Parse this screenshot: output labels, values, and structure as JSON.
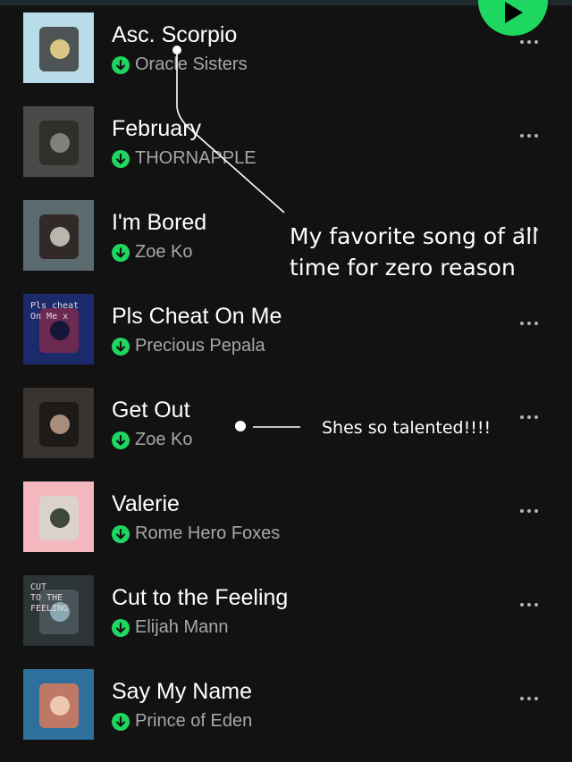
{
  "tracks": [
    {
      "title": "Asc. Scorpio",
      "artist": "Oracle Sisters",
      "art_colors": [
        "#b9dde8",
        "#3b3b3b",
        "#e8d38a"
      ]
    },
    {
      "title": "February",
      "artist": "THORNAPPLE",
      "art_colors": [
        "#4a4a48",
        "#2a2a28",
        "#8a8a86"
      ]
    },
    {
      "title": "I'm Bored",
      "artist": "Zoe Ko",
      "art_colors": [
        "#5b6b70",
        "#2b1f1c",
        "#c9c5bd"
      ]
    },
    {
      "title": "Pls Cheat On Me",
      "artist": "Precious Pepala",
      "art_colors": [
        "#1b2a6b",
        "#7a2a4e",
        "#0d1433"
      ],
      "art_text": [
        "Pls cheat",
        "On Me x"
      ]
    },
    {
      "title": "Get Out",
      "artist": "Zoe Ko",
      "art_colors": [
        "#3a3430",
        "#1a1614",
        "#b89a86"
      ]
    },
    {
      "title": "Valerie",
      "artist": "Rome Hero Foxes",
      "art_colors": [
        "#f2b8bd",
        "#d8d6cf",
        "#2d3a2a"
      ]
    },
    {
      "title": "Cut to the Feeling",
      "artist": "Elijah Mann",
      "art_colors": [
        "#2d3436",
        "#4f5b5e",
        "#8fb3bd"
      ],
      "art_text": [
        "CUT",
        "TO THE",
        "FEELING"
      ]
    },
    {
      "title": "Say My Name",
      "artist": "Prince of Eden",
      "art_colors": [
        "#2f6f9e",
        "#d97a5c",
        "#f1d0b8"
      ]
    }
  ],
  "annotations": {
    "favorite_line1": "My favorite song of all",
    "favorite_line2": "time for zero reason",
    "talented": "Shes so talented!!!!"
  },
  "colors": {
    "accent": "#1ed760",
    "background": "#121212",
    "subtext": "#a7a7a7"
  }
}
